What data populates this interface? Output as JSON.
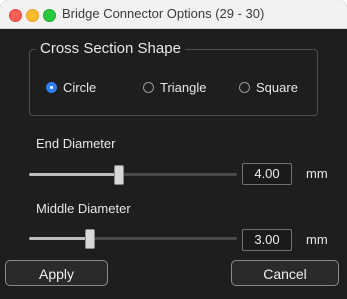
{
  "window": {
    "title": "Bridge Connector Options (29 - 30)"
  },
  "cross_section": {
    "title": "Cross Section Shape",
    "options": [
      {
        "label": "Circle",
        "selected": true
      },
      {
        "label": "Triangle",
        "selected": false
      },
      {
        "label": "Square",
        "selected": false
      }
    ]
  },
  "end_diameter": {
    "label": "End Diameter",
    "value": "4.00",
    "unit": "mm",
    "slider_fraction": 0.43
  },
  "middle_diameter": {
    "label": "Middle Diameter",
    "value": "3.00",
    "unit": "mm",
    "slider_fraction": 0.29
  },
  "buttons": {
    "apply": "Apply",
    "cancel": "Cancel"
  },
  "colors": {
    "accent": "#2d7ff9",
    "window_bg": "#1e1e1e",
    "close": "#ff5f57",
    "minimize": "#febc2e",
    "maximize": "#28c840"
  },
  "icons": {
    "close": "close-traffic-light-icon",
    "minimize": "minimize-traffic-light-icon",
    "maximize": "maximize-traffic-light-icon"
  }
}
